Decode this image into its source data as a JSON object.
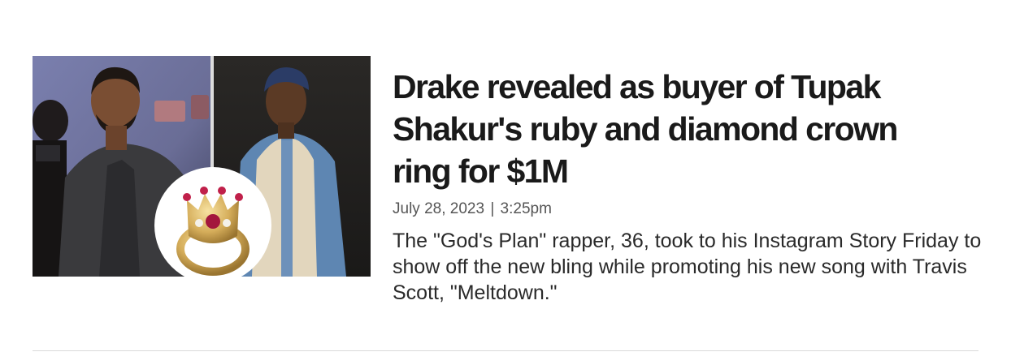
{
  "article": {
    "headline": "Drake revealed as buyer of Tupak Shakur's ruby and diamond crown ring for $1M",
    "date": "July 28, 2023",
    "separator": "|",
    "time": "3:25pm",
    "summary": "The \"God's Plan\" rapper, 36, took to his Instagram Story Friday to show off the new bling while promoting his new song with Travis Scott, \"Meltdown.\""
  }
}
